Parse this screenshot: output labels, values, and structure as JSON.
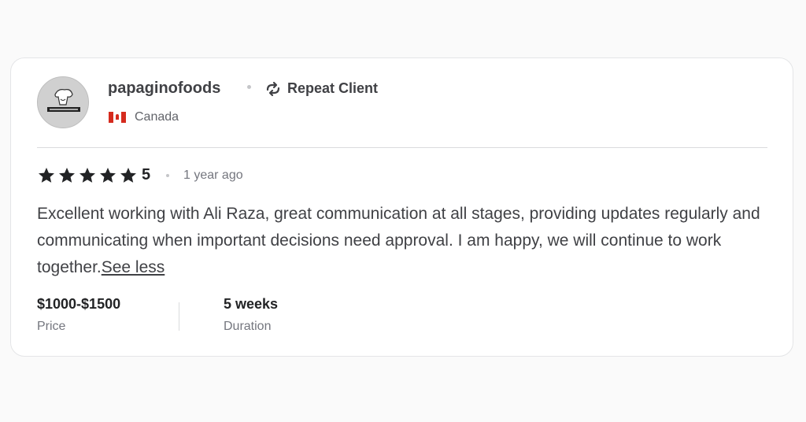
{
  "review": {
    "username": "papaginofoods",
    "repeat_client_label": "Repeat Client",
    "repeat_icon": "repeat-arrows-icon",
    "country": "Canada",
    "flag_icon": "canada-flag-icon",
    "stars": 5,
    "rating": "5",
    "time_ago": "1 year ago",
    "text": "Excellent working with Ali Raza, great communication at all stages, providing updates regularly and communicating when important decisions need approval. I am happy, we will continue to work together.",
    "see_less_label": "See less",
    "price_value": "$1000-$1500",
    "price_label": "Price",
    "duration_value": "5 weeks",
    "duration_label": "Duration"
  },
  "colors": {
    "star": "#222325",
    "flag_red": "#d52b1e",
    "text": "#404145",
    "muted": "#74767e"
  }
}
